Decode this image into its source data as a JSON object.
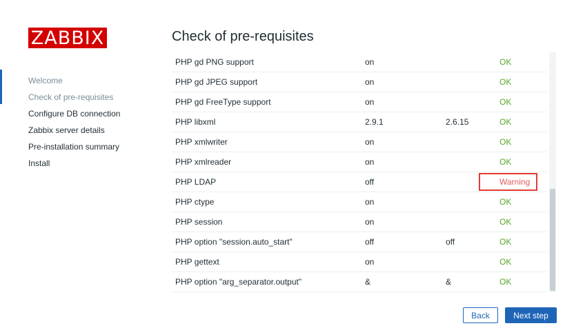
{
  "logo": "ZABBIX",
  "title": "Check of pre-requisites",
  "steps": [
    {
      "label": "Welcome",
      "state": "done"
    },
    {
      "label": "Check of pre-requisites",
      "state": "current"
    },
    {
      "label": "Configure DB connection",
      "state": "pending"
    },
    {
      "label": "Zabbix server details",
      "state": "pending"
    },
    {
      "label": "Pre-installation summary",
      "state": "pending"
    },
    {
      "label": "Install",
      "state": "pending"
    }
  ],
  "requirements": [
    {
      "name": "PHP gd PNG support",
      "current": "on",
      "required": "",
      "status": "OK"
    },
    {
      "name": "PHP gd JPEG support",
      "current": "on",
      "required": "",
      "status": "OK"
    },
    {
      "name": "PHP gd FreeType support",
      "current": "on",
      "required": "",
      "status": "OK"
    },
    {
      "name": "PHP libxml",
      "current": "2.9.1",
      "required": "2.6.15",
      "status": "OK"
    },
    {
      "name": "PHP xmlwriter",
      "current": "on",
      "required": "",
      "status": "OK"
    },
    {
      "name": "PHP xmlreader",
      "current": "on",
      "required": "",
      "status": "OK"
    },
    {
      "name": "PHP LDAP",
      "current": "off",
      "required": "",
      "status": "Warning"
    },
    {
      "name": "PHP ctype",
      "current": "on",
      "required": "",
      "status": "OK"
    },
    {
      "name": "PHP session",
      "current": "on",
      "required": "",
      "status": "OK"
    },
    {
      "name": "PHP option \"session.auto_start\"",
      "current": "off",
      "required": "off",
      "status": "OK"
    },
    {
      "name": "PHP gettext",
      "current": "on",
      "required": "",
      "status": "OK"
    },
    {
      "name": "PHP option \"arg_separator.output\"",
      "current": "&",
      "required": "&",
      "status": "OK"
    }
  ],
  "buttons": {
    "back": "Back",
    "next": "Next step"
  },
  "colors": {
    "ok": "#59a326",
    "warning": "#e45959",
    "highlight_box": "#e53935",
    "brand": "#d40000",
    "accent": "#1f65b7"
  }
}
